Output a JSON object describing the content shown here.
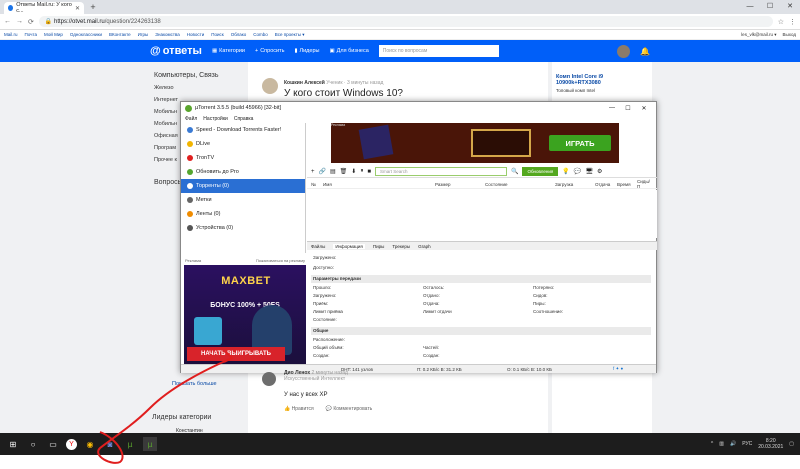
{
  "browser": {
    "tab_title": "Ответы Mail.ru: У кого с...",
    "url_host": "https://otvet.mail.ru",
    "url_path": "/question/224263138"
  },
  "bookmarks": [
    "Mail.ru",
    "Почта",
    "Мой Мир",
    "Одноклассники",
    "ВКонтакте",
    "Игры",
    "Знакомства",
    "Новости",
    "Поиск",
    "Облако",
    "Combo",
    "Все проекты ▾"
  ],
  "account": {
    "email": "les_vlk@mail.ru ▾",
    "exit": "Выход"
  },
  "header": {
    "logo": "ответы",
    "categories": "Категории",
    "ask": "Спросить",
    "leaders": "Лидеры",
    "business": "Для бизнеса",
    "search_placeholder": "Поиск по вопросам"
  },
  "leftcol": {
    "heading": "Компьютеры, Связь",
    "items": [
      "Железо",
      "Интернет",
      "Мобильн",
      "Мобильн",
      "Офисная",
      "Програм",
      "Прочее к"
    ],
    "questions": "Вопросы"
  },
  "question": {
    "author": "Кошкин Алексей",
    "meta": "Ученик · 3 минуты назад",
    "title": "У кого стоит Windows 10?"
  },
  "right_ad": {
    "title": "Комп Intel Core i9 10900k+RTX3080",
    "sub": "Топовый комп Intel"
  },
  "ut": {
    "title": "µTorrent 3.5.5 (build 45966) [32-bit]",
    "menu": [
      "Файл",
      "Настройки",
      "Справка"
    ],
    "sidebar": [
      {
        "label": "Speed - Download Torrents Faster!",
        "color": "#3b7bd4"
      },
      {
        "label": "DLive",
        "color": "#f2b500"
      },
      {
        "label": "TronTV",
        "color": "#e02020"
      },
      {
        "label": "Обновить до Pro",
        "color": "#55a630"
      },
      {
        "label": "Торренты (0)",
        "color": "#ffffff",
        "sel": true
      },
      {
        "label": "Метки",
        "color": "#666666"
      },
      {
        "label": "Ленты (0)",
        "color": "#f08c00"
      },
      {
        "label": "Устройства (0)",
        "color": "#555555"
      }
    ],
    "ad_label_left": "Реклама",
    "ad_label_right": "Пожаловаться на рекламу",
    "ad": {
      "brand": "MAXBET",
      "bonus": "БОНУС 100% + 50FS",
      "button": "НАЧАТЬ ВЫИГРЫВАТЬ"
    },
    "banner": {
      "label": "Реклама",
      "button": "ИГРАТЬ"
    },
    "search_placeholder": "Smart Search",
    "update_btn": "Обновления",
    "columns": [
      "№",
      "Имя",
      "Размер",
      "Состояние",
      "Загрузка",
      "Отдача",
      "Время",
      "Сиды/П"
    ],
    "tabs": [
      "Файлы",
      "Информация",
      "Пиры",
      "Трекеры",
      "Graph"
    ],
    "downloaded_label": "Загружено:",
    "available_label": "Доступно:",
    "transfer_head": "Параметры передачи",
    "transfer": [
      [
        "Прошло:",
        "Осталось:",
        "Потеряно:"
      ],
      [
        "Загружено:",
        "Отдано:",
        "Сидов:"
      ],
      [
        "Приём:",
        "Отдача:",
        "Пиры:"
      ],
      [
        "Лимит приёма",
        "Лимит отдачи",
        "Соотношение:"
      ],
      [
        "Состояние:",
        "",
        ""
      ]
    ],
    "general_head": "Общие",
    "general": [
      [
        "Расположение:",
        "",
        ""
      ],
      [
        "Общий объём:",
        "Частей:",
        ""
      ],
      [
        "Создан:",
        "Создан:",
        ""
      ]
    ],
    "status": {
      "dht": "DHT: 141 узлов",
      "down": "П: 0.2 КБ/с В: 31.2 КБ",
      "up": "О: 0.1 КБ/с В: 10.0 КБ"
    }
  },
  "comment": {
    "author": "Дио Ленох",
    "meta": "Искусственный Интеллект",
    "when": "2 минуты назад",
    "text": "У нас у всех XP",
    "like": "Нравится",
    "comment": "Комментировать"
  },
  "showmore": "Показать больше",
  "leaders_title": "Лидеры категории",
  "leader_name": "Константин",
  "taskbar": {
    "lang": "РУС",
    "time": "8:20",
    "date": "20.03.2021"
  }
}
